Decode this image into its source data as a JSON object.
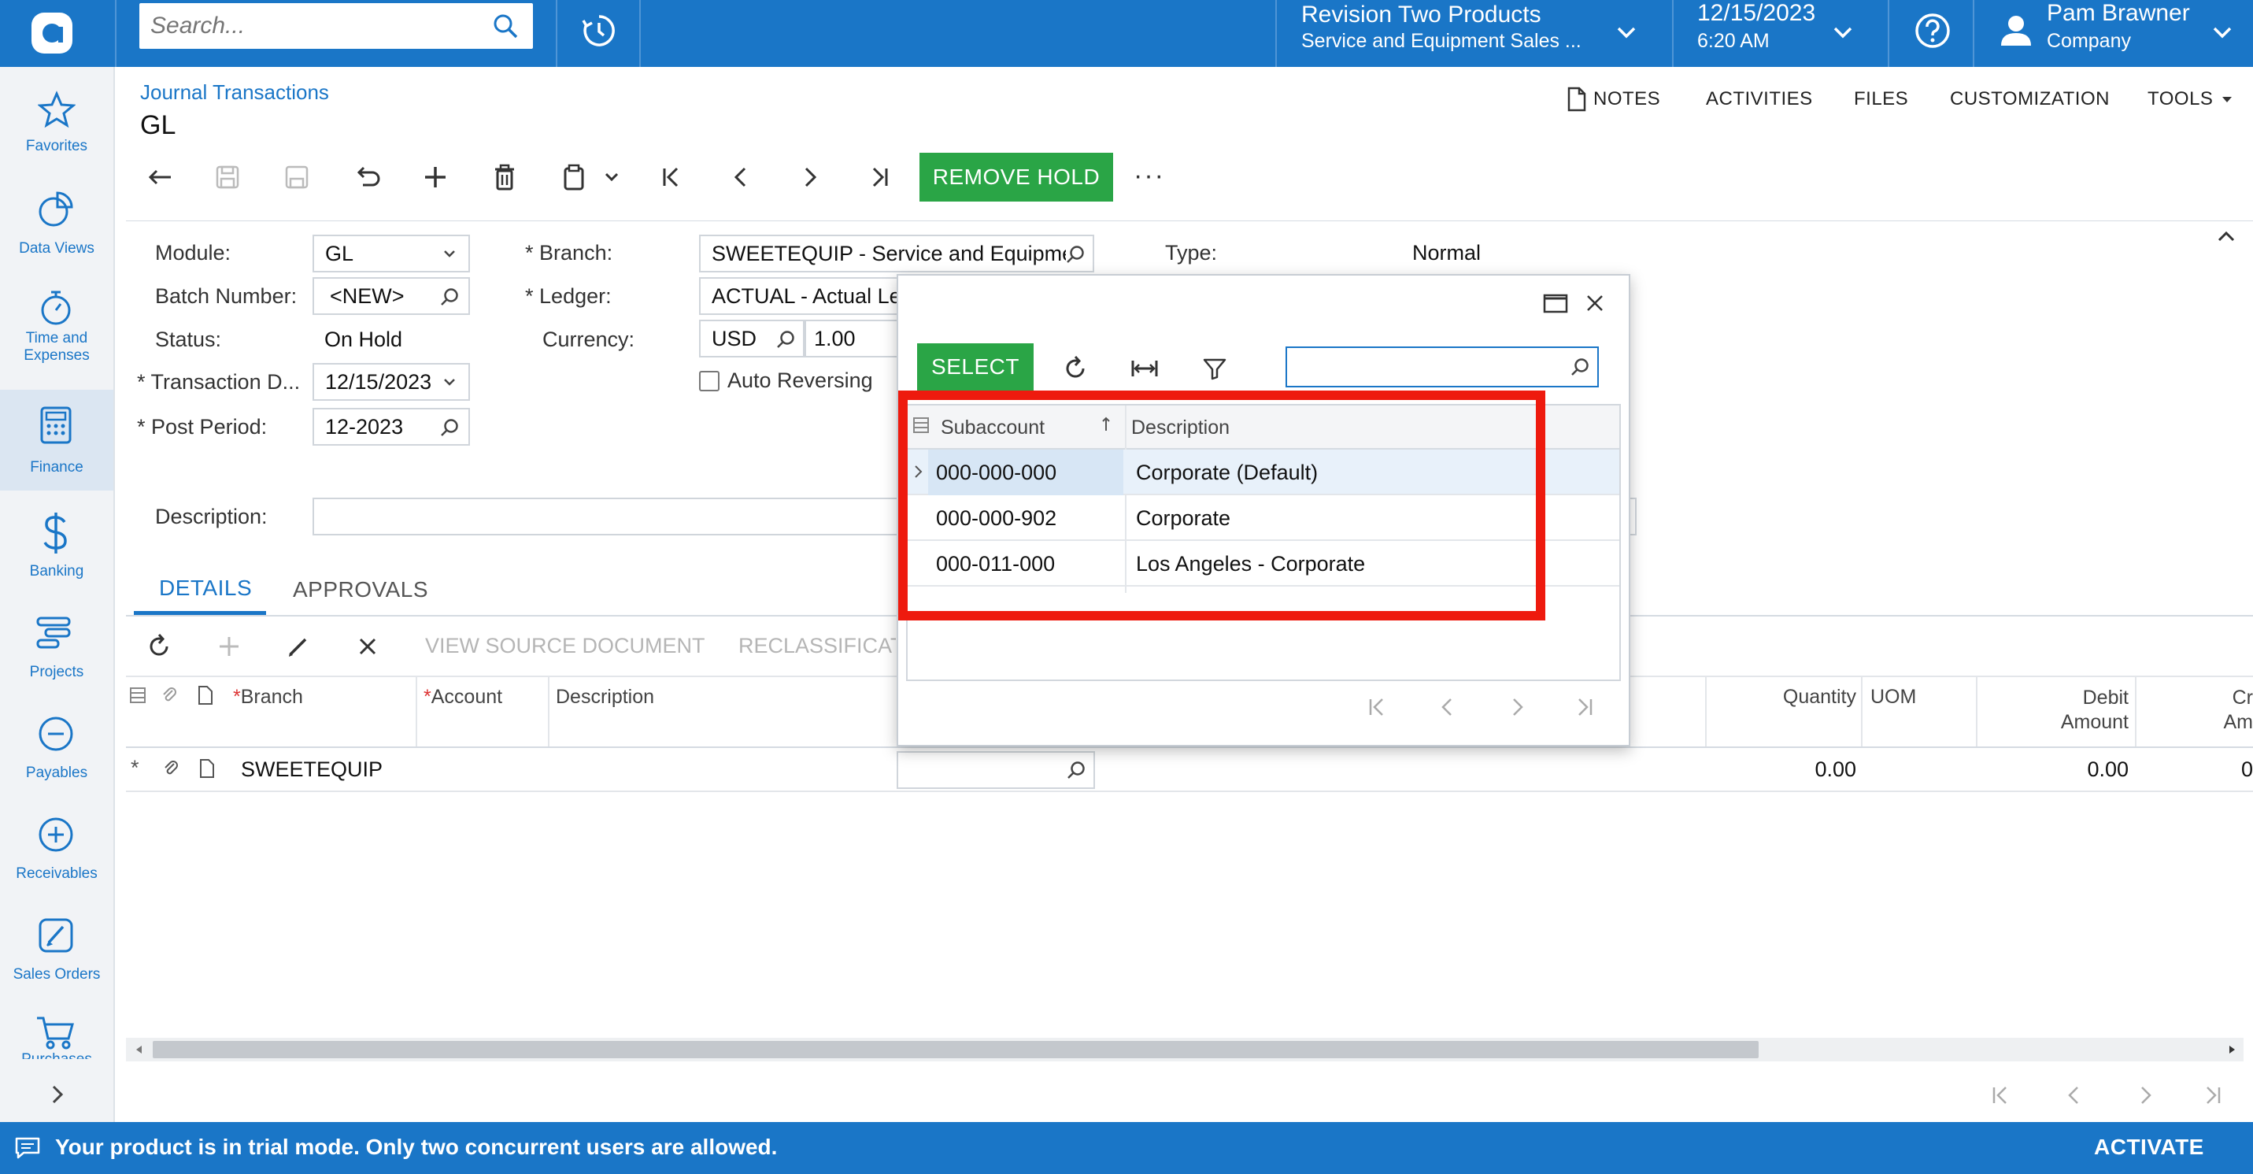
{
  "topbar": {
    "search_placeholder": "Search...",
    "company_title": "Revision Two Products",
    "company_sub": "Service and Equipment Sales ...",
    "date": "12/15/2023",
    "time": "6:20 AM",
    "user_name": "Pam Brawner",
    "user_sub": "Company"
  },
  "sidebar": {
    "items": [
      {
        "label": "Favorites",
        "icon": "star-icon"
      },
      {
        "label": "Data Views",
        "icon": "pie-chart-icon"
      },
      {
        "label": "Time and Expenses",
        "icon": "stopwatch-icon"
      },
      {
        "label": "Finance",
        "icon": "calculator-icon"
      },
      {
        "label": "Banking",
        "icon": "dollar-icon"
      },
      {
        "label": "Projects",
        "icon": "projects-icon"
      },
      {
        "label": "Payables",
        "icon": "minus-circle-icon"
      },
      {
        "label": "Receivables",
        "icon": "plus-circle-icon"
      },
      {
        "label": "Sales Orders",
        "icon": "edit-icon"
      },
      {
        "label": "Purchases",
        "icon": "cart-icon"
      }
    ],
    "expand_label": ">"
  },
  "header": {
    "breadcrumb": "Journal Transactions",
    "title": "GL",
    "links": {
      "notes": "NOTES",
      "activities": "ACTIVITIES",
      "files": "FILES",
      "customization": "CUSTOMIZATION",
      "tools": "TOOLS"
    }
  },
  "toolbar": {
    "remove_hold_label": "REMOVE HOLD",
    "more_label": "···"
  },
  "form": {
    "module_label": "Module:",
    "module_value": "GL",
    "batch_label": "Batch Number:",
    "batch_value": "<NEW>",
    "status_label": "Status:",
    "status_value": "On Hold",
    "trans_date_label": "Transaction D...",
    "trans_date_value": "12/15/2023",
    "post_period_label": "Post Period:",
    "post_period_value": "12-2023",
    "branch_label": "Branch:",
    "branch_value": "SWEETEQUIP - Service and Equipme",
    "ledger_label": "Ledger:",
    "ledger_value": "ACTUAL - Actual Led",
    "currency_label": "Currency:",
    "currency_value": "USD",
    "currency_rate": "1.00",
    "auto_reversing_label": "Auto Reversing",
    "type_label": "Type:",
    "type_value": "Normal",
    "description_label": "Description:",
    "description_value": ""
  },
  "tabs": {
    "details": "DETAILS",
    "approvals": "APPROVALS"
  },
  "grid_toolbar": {
    "view_source": "VIEW SOURCE DOCUMENT",
    "reclassify": "RECLASSIFICAT"
  },
  "grid": {
    "headers": {
      "branch": "Branch",
      "account": "Account",
      "description": "Description",
      "quantity": "Quantity",
      "uom": "UOM",
      "debit_1": "Debit",
      "debit_2": "Amount",
      "credit_1": "Cr",
      "credit_2": "Am"
    },
    "row": {
      "marker": "*",
      "branch": "SWEETEQUIP",
      "quantity": "0.00",
      "debit": "0.00",
      "credit": "0"
    }
  },
  "popup": {
    "select_label": "SELECT",
    "search_value": "",
    "headers": {
      "subaccount": "Subaccount",
      "description": "Description"
    },
    "rows": [
      {
        "subaccount": "000-000-000",
        "description": "Corporate (Default)"
      },
      {
        "subaccount": "000-000-902",
        "description": "Corporate"
      },
      {
        "subaccount": "000-011-000",
        "description": "Los Angeles - Corporate"
      }
    ]
  },
  "bottombar": {
    "message": "Your product is in trial mode. Only two concurrent users are allowed.",
    "activate": "ACTIVATE"
  },
  "colors": {
    "brand_blue": "#1a76c7",
    "select_green": "#2aa546",
    "highlight_red": "#ee1a0e"
  }
}
